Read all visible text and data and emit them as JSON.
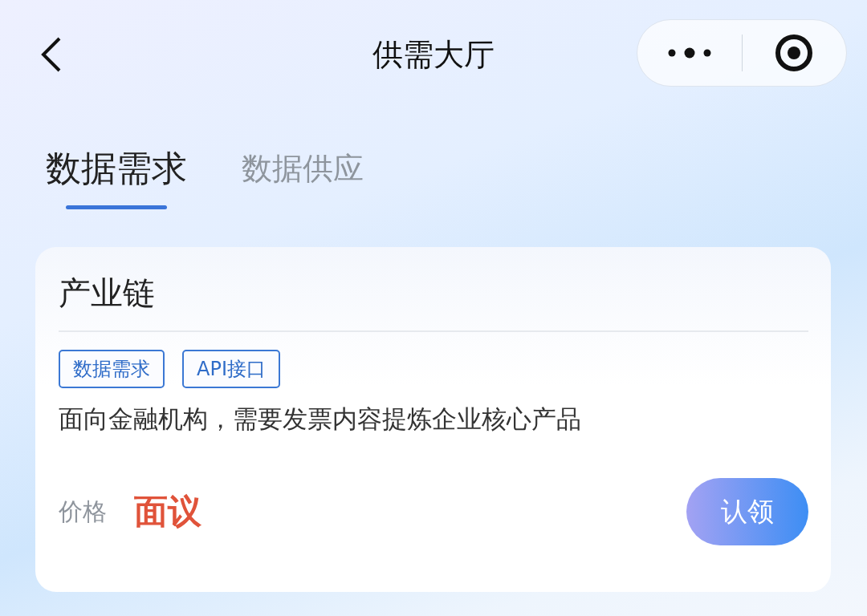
{
  "header": {
    "title": "供需大厅"
  },
  "tabs": [
    {
      "label": "数据需求",
      "selected": true
    },
    {
      "label": "数据供应",
      "selected": false
    }
  ],
  "cards": [
    {
      "title": "产业链",
      "tags": [
        "数据需求",
        "API接口"
      ],
      "description": "面向金融机构，需要发票内容提炼企业核心产品",
      "price_label": "价格",
      "price": "面议",
      "action": "认领"
    }
  ]
}
